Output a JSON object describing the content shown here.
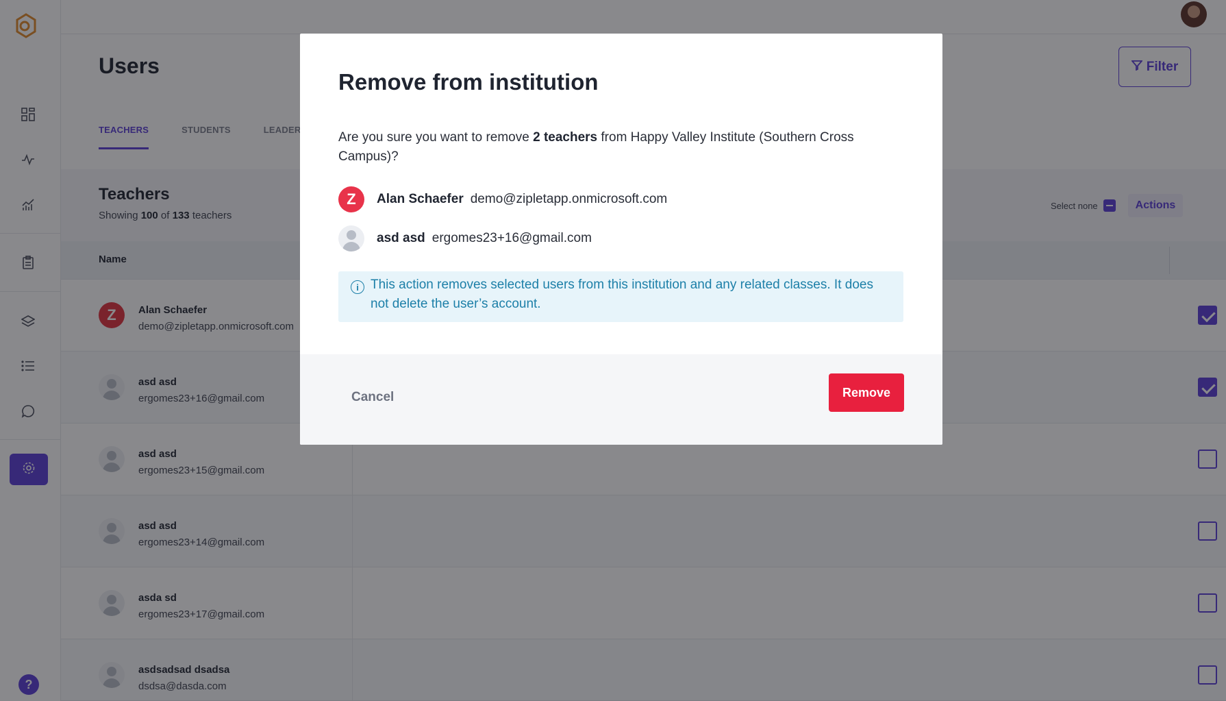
{
  "header": {
    "title": "Users",
    "filter_label": "Filter",
    "tabs": [
      {
        "label": "TEACHERS",
        "active": true
      },
      {
        "label": "STUDENTS",
        "active": false
      },
      {
        "label": "LEADERS",
        "active": false
      }
    ]
  },
  "sidebar": {
    "icons": [
      "dashboard-icon",
      "activity-icon",
      "chart-icon",
      "clipboard-icon",
      "layers-icon",
      "list-icon",
      "chat-icon",
      "settings-icon"
    ],
    "help_label": "?"
  },
  "section": {
    "title": "Teachers",
    "showing_prefix": "Showing",
    "showing_count": "100",
    "showing_of": "of",
    "showing_total": "133",
    "showing_suffix": "teachers",
    "select_none_label": "Select none",
    "actions_label": "Actions"
  },
  "table": {
    "column_name": "Name",
    "rows": [
      {
        "name": "Alan Schaefer",
        "email": "demo@zipletapp.onmicrosoft.com",
        "avatar": "Z",
        "checked": true
      },
      {
        "name": "asd asd",
        "email": "ergomes23+16@gmail.com",
        "avatar": "person",
        "checked": true
      },
      {
        "name": "asd asd",
        "email": "ergomes23+15@gmail.com",
        "avatar": "person",
        "checked": false
      },
      {
        "name": "asd asd",
        "email": "ergomes23+14@gmail.com",
        "avatar": "person",
        "checked": false
      },
      {
        "name": "asda sd",
        "email": "ergomes23+17@gmail.com",
        "avatar": "person",
        "checked": false
      },
      {
        "name": "asdsadsad dsadsa",
        "email": "dsdsa@dasda.com",
        "avatar": "person",
        "checked": false
      }
    ]
  },
  "modal": {
    "title": "Remove from institution",
    "text_prefix": "Are you sure you want to remove",
    "text_bold": "2 teachers",
    "text_suffix": "from Happy Valley Institute (Southern Cross Campus)?",
    "users": [
      {
        "name": "Alan Schaefer",
        "email": "demo@zipletapp.onmicrosoft.com",
        "avatar": "Z"
      },
      {
        "name": "asd asd",
        "email": "ergomes23+16@gmail.com",
        "avatar": "person"
      }
    ],
    "info_icon": "i",
    "info_text": "This action removes selected users from this institution and any related classes. It does not delete the user’s account.",
    "cancel_label": "Cancel",
    "remove_label": "Remove"
  },
  "colors": {
    "accent": "#5b3fd6",
    "danger": "#e8203e",
    "info": "#1c7fa8",
    "info_bg": "#e7f4fa"
  }
}
